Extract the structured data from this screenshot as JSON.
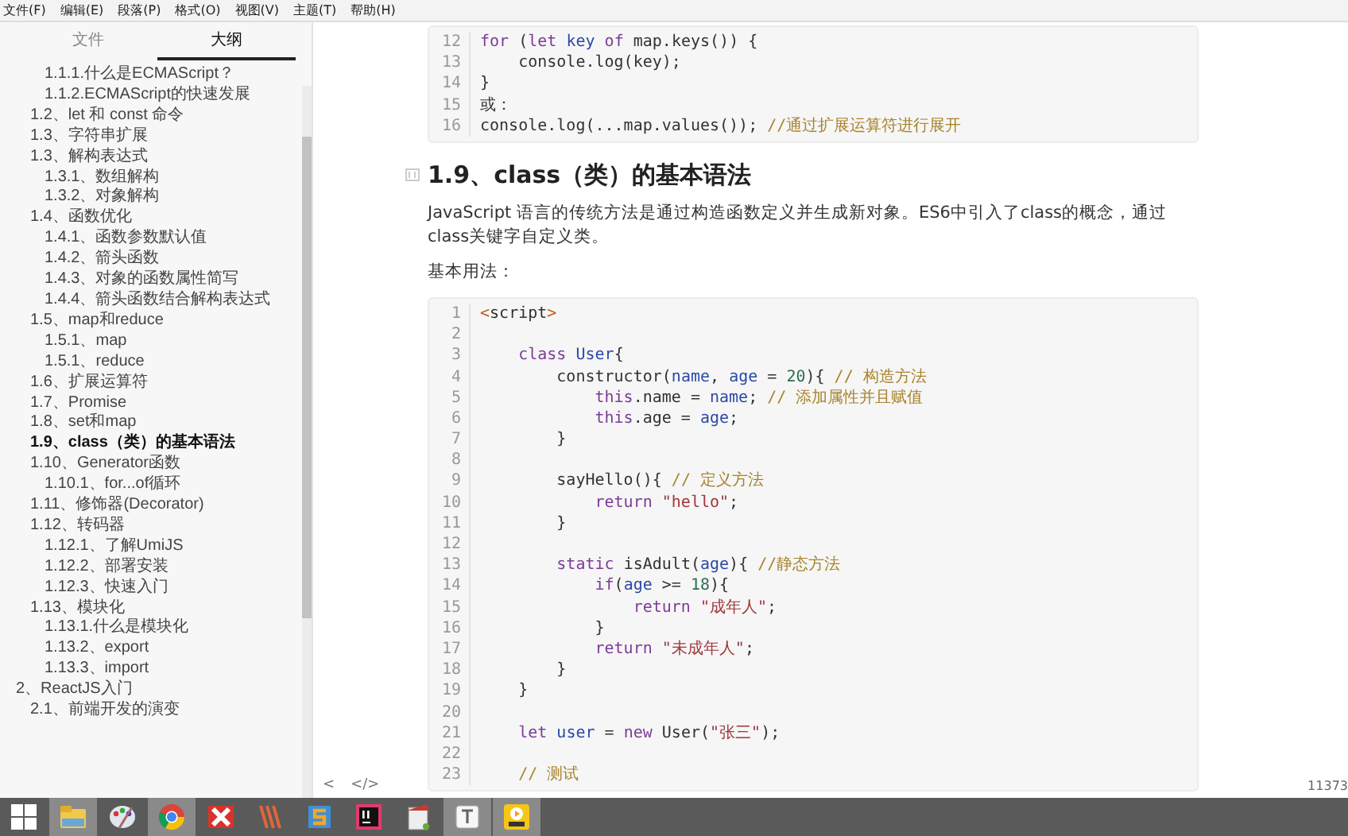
{
  "menu": [
    "文件(F)",
    "编辑(E)",
    "段落(P)",
    "格式(O)",
    "视图(V)",
    "主题(T)",
    "帮助(H)"
  ],
  "sidebar": {
    "tabs": [
      {
        "label": "文件",
        "selected": false
      },
      {
        "label": "大纲",
        "selected": true
      }
    ],
    "outline": [
      {
        "children": [
          {
            "children": [
              {
                "label": "1.1.1.什么是ECMAScript？",
                "selected": false
              },
              {
                "label": "1.1.2.ECMAScript的快速发展",
                "selected": false
              }
            ]
          },
          {
            "label": "1.2、let 和 const 命令",
            "selected": false
          },
          {
            "label": "1.3、字符串扩展",
            "selected": false
          },
          {
            "label": "1.3、解构表达式",
            "selected": false,
            "children": [
              {
                "label": "1.3.1、数组解构",
                "selected": false
              },
              {
                "label": "1.3.2、对象解构",
                "selected": false
              }
            ]
          },
          {
            "label": "1.4、函数优化",
            "selected": false,
            "children": [
              {
                "label": "1.4.1、函数参数默认值",
                "selected": false
              },
              {
                "label": "1.4.2、箭头函数",
                "selected": false
              },
              {
                "label": "1.4.3、对象的函数属性简写",
                "selected": false
              },
              {
                "label": "1.4.4、箭头函数结合解构表达式",
                "selected": false
              }
            ]
          },
          {
            "label": "1.5、map和reduce",
            "selected": false,
            "children": [
              {
                "label": "1.5.1、map",
                "selected": false
              },
              {
                "label": "1.5.1、reduce",
                "selected": false
              }
            ]
          },
          {
            "label": "1.6、扩展运算符",
            "selected": false
          },
          {
            "label": "1.7、Promise",
            "selected": false
          },
          {
            "label": "1.8、set和map",
            "selected": false
          },
          {
            "label": "1.9、class（类）的基本语法",
            "selected": true
          },
          {
            "label": "1.10、Generator函数",
            "selected": false,
            "children": [
              {
                "label": "1.10.1、for...of循环",
                "selected": false
              }
            ]
          },
          {
            "label": "1.11、修饰器(Decorator)",
            "selected": false
          },
          {
            "label": "1.12、转码器",
            "selected": false,
            "children": [
              {
                "label": "1.12.1、了解UmiJS",
                "selected": false
              },
              {
                "label": "1.12.2、部署安装",
                "selected": false
              },
              {
                "label": "1.12.3、快速入门",
                "selected": false
              }
            ]
          },
          {
            "label": "1.13、模块化",
            "selected": false,
            "children": [
              {
                "label": "1.13.1.什么是模块化",
                "selected": false
              },
              {
                "label": "1.13.2、export",
                "selected": false
              },
              {
                "label": "1.13.3、import",
                "selected": false
              }
            ]
          }
        ]
      },
      {
        "label": "2、ReactJS入门",
        "selected": false,
        "children": [
          {
            "label": "2.1、前端开发的演变",
            "selected": false
          }
        ]
      }
    ]
  },
  "editor": {
    "blocks": [
      {
        "kind": "code",
        "lines": [
          {
            "number": "12",
            "tokens": [
              {
                "kind": "keyword",
                "text": "for"
              },
              {
                "kind": "plain",
                "text": " ("
              },
              {
                "kind": "keyword",
                "text": "let "
              },
              {
                "kind": "variable",
                "text": "key "
              },
              {
                "kind": "keyword",
                "text": "of"
              },
              {
                "kind": "plain",
                "text": " map.keys()) {"
              }
            ]
          },
          {
            "number": "13",
            "tokens": [
              {
                "kind": "plain",
                "text": "    console.log(key);"
              }
            ]
          },
          {
            "number": "14",
            "tokens": [
              {
                "kind": "plain",
                "text": "}"
              }
            ]
          },
          {
            "number": "15",
            "tokens": [
              {
                "kind": "plain",
                "text": "或："
              }
            ]
          },
          {
            "number": "16",
            "tokens": [
              {
                "kind": "plain",
                "text": "console.log(...map.values()); "
              },
              {
                "kind": "comment",
                "text": "//通过扩展运算符进行展开"
              }
            ]
          }
        ]
      },
      {
        "kind": "heading",
        "text": "1.9、class（类）的基本语法"
      },
      {
        "kind": "paragraph",
        "text": "JavaScript 语言的传统方法是通过构造函数定义并生成新对象。ES6中引入了class的概念，通过class关键字自定义类。"
      },
      {
        "kind": "paragraph",
        "text": "基本用法："
      },
      {
        "kind": "code",
        "lines": [
          {
            "number": "1",
            "tokens": [
              {
                "kind": "tag",
                "text": "<"
              },
              {
                "kind": "plain",
                "text": "script"
              },
              {
                "kind": "tag",
                "text": ">"
              }
            ]
          },
          {
            "number": "2"
          },
          {
            "number": "3",
            "tokens": [
              {
                "kind": "keyword",
                "text": "    class "
              },
              {
                "kind": "variable",
                "text": "User"
              },
              {
                "kind": "plain",
                "text": "{"
              }
            ]
          },
          {
            "number": "4",
            "tokens": [
              {
                "kind": "plain",
                "text": "        constructor("
              },
              {
                "kind": "variable",
                "text": "name"
              },
              {
                "kind": "plain",
                "text": ", "
              },
              {
                "kind": "variable",
                "text": "age"
              },
              {
                "kind": "plain",
                "text": " = "
              },
              {
                "kind": "number",
                "text": "20"
              },
              {
                "kind": "plain",
                "text": "){ "
              },
              {
                "kind": "comment",
                "text": "// 构造方法"
              }
            ]
          },
          {
            "number": "5",
            "tokens": [
              {
                "kind": "keyword",
                "text": "            this"
              },
              {
                "kind": "plain",
                "text": ".name = "
              },
              {
                "kind": "variable",
                "text": "name"
              },
              {
                "kind": "plain",
                "text": "; "
              },
              {
                "kind": "comment",
                "text": "// 添加属性并且赋值"
              }
            ]
          },
          {
            "number": "6",
            "tokens": [
              {
                "kind": "keyword",
                "text": "            this"
              },
              {
                "kind": "plain",
                "text": ".age = "
              },
              {
                "kind": "variable",
                "text": "age"
              },
              {
                "kind": "plain",
                "text": ";"
              }
            ]
          },
          {
            "number": "7",
            "tokens": [
              {
                "kind": "plain",
                "text": "        }"
              }
            ]
          },
          {
            "number": "8"
          },
          {
            "number": "9",
            "tokens": [
              {
                "kind": "plain",
                "text": "        sayHello(){ "
              },
              {
                "kind": "comment",
                "text": "// 定义方法"
              }
            ]
          },
          {
            "number": "10",
            "tokens": [
              {
                "kind": "keyword",
                "text": "            return "
              },
              {
                "kind": "string",
                "text": "\"hello\""
              },
              {
                "kind": "plain",
                "text": ";"
              }
            ]
          },
          {
            "number": "11",
            "tokens": [
              {
                "kind": "plain",
                "text": "        }"
              }
            ]
          },
          {
            "number": "12"
          },
          {
            "number": "13",
            "tokens": [
              {
                "kind": "keyword",
                "text": "        static"
              },
              {
                "kind": "plain",
                "text": " isAdult("
              },
              {
                "kind": "variable",
                "text": "age"
              },
              {
                "kind": "plain",
                "text": "){ "
              },
              {
                "kind": "comment",
                "text": "//静态方法"
              }
            ]
          },
          {
            "number": "14",
            "tokens": [
              {
                "kind": "keyword",
                "text": "            if"
              },
              {
                "kind": "plain",
                "text": "("
              },
              {
                "kind": "variable",
                "text": "age"
              },
              {
                "kind": "plain",
                "text": " >= "
              },
              {
                "kind": "number",
                "text": "18"
              },
              {
                "kind": "plain",
                "text": "){"
              }
            ]
          },
          {
            "number": "15",
            "tokens": [
              {
                "kind": "keyword",
                "text": "                return "
              },
              {
                "kind": "string",
                "text": "\"成年人\""
              },
              {
                "kind": "plain",
                "text": ";"
              }
            ]
          },
          {
            "number": "16",
            "tokens": [
              {
                "kind": "plain",
                "text": "            }"
              }
            ]
          },
          {
            "number": "17",
            "tokens": [
              {
                "kind": "keyword",
                "text": "            return "
              },
              {
                "kind": "string",
                "text": "\"未成年人\""
              },
              {
                "kind": "plain",
                "text": ";"
              }
            ]
          },
          {
            "number": "18",
            "tokens": [
              {
                "kind": "plain",
                "text": "        }"
              }
            ]
          },
          {
            "number": "19",
            "tokens": [
              {
                "kind": "plain",
                "text": "    }"
              }
            ]
          },
          {
            "number": "20"
          },
          {
            "number": "21",
            "tokens": [
              {
                "kind": "keyword",
                "text": "    let "
              },
              {
                "kind": "variable",
                "text": "user"
              },
              {
                "kind": "plain",
                "text": " = "
              },
              {
                "kind": "keyword",
                "text": "new"
              },
              {
                "kind": "plain",
                "text": " User("
              },
              {
                "kind": "string",
                "text": "\"张三\""
              },
              {
                "kind": "plain",
                "text": ");"
              }
            ]
          },
          {
            "number": "22"
          },
          {
            "number": "23",
            "tokens": [
              {
                "kind": "comment",
                "text": "    // 测试"
              }
            ]
          }
        ]
      }
    ],
    "footer": {
      "buttons": [
        "<",
        "</>"
      ],
      "word_count": "11373"
    }
  },
  "taskbar": {
    "apps": [
      {
        "kind": "folder",
        "active": true
      },
      {
        "kind": "paint",
        "active": false
      },
      {
        "kind": "browser",
        "active": true
      },
      {
        "kind": "x",
        "active": false
      },
      {
        "kind": "stripes",
        "active": false
      },
      {
        "kind": "s",
        "active": false
      },
      {
        "kind": "ij",
        "active": false
      },
      {
        "kind": "notepad",
        "active": false
      },
      {
        "kind": "t",
        "active": true
      },
      {
        "kind": "player",
        "active": true
      }
    ]
  }
}
